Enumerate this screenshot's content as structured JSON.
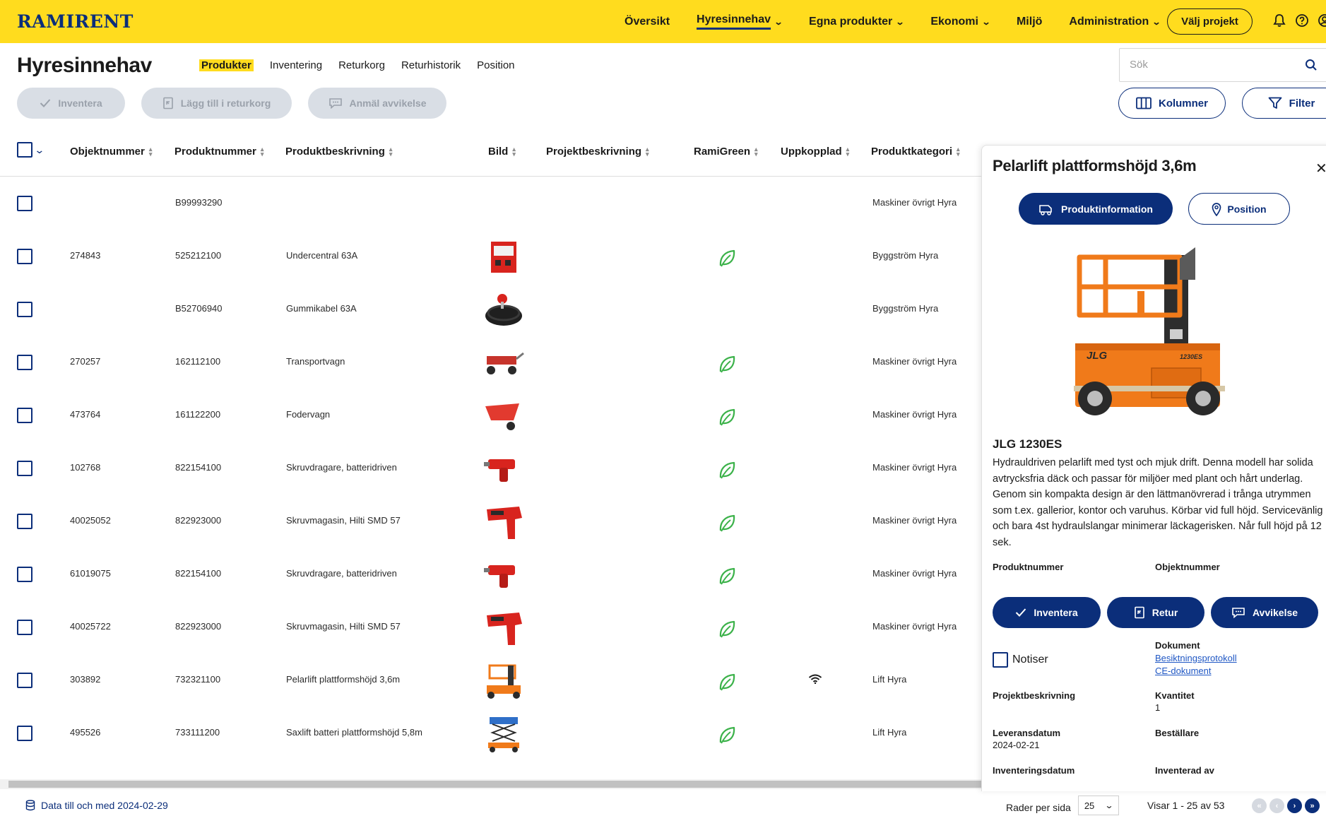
{
  "brand": {
    "logo_text": "RAMIRENT",
    "accent": "#ffdc1e",
    "primary": "#0b2e7a"
  },
  "topnav": {
    "items": [
      {
        "label": "Översikt"
      },
      {
        "label": "Hyresinnehav"
      },
      {
        "label": "Egna produkter"
      },
      {
        "label": "Ekonomi"
      },
      {
        "label": "Miljö"
      },
      {
        "label": "Administration"
      }
    ],
    "project_button": "Välj projekt",
    "icons": [
      "bell-icon",
      "help-icon",
      "user-icon"
    ]
  },
  "page": {
    "title": "Hyresinnehav",
    "subtabs": [
      "Produkter",
      "Inventering",
      "Returkorg",
      "Returhistorik",
      "Position"
    ],
    "active_subtab": "Produkter"
  },
  "search": {
    "placeholder": "Sök",
    "value": ""
  },
  "actions": {
    "inventera": "Inventera",
    "returkorg": "Lägg till i returkorg",
    "avvikelse": "Anmäl avvikelse",
    "kolumner": "Kolumner",
    "filter": "Filter"
  },
  "table": {
    "columns": [
      "Objektnummer",
      "Produktnummer",
      "Produktbeskrivning",
      "Bild",
      "Projektbeskrivning",
      "RamiGreen",
      "Uppkopplad",
      "Produktkategori"
    ],
    "rows": [
      {
        "obj": "",
        "prod": "B99993290",
        "desc": "",
        "image": "",
        "green": false,
        "wifi": false,
        "cat": "Maskiner övrigt Hyra"
      },
      {
        "obj": "274843",
        "prod": "525212100",
        "desc": "Undercentral 63A",
        "image": "distribution-box",
        "green": true,
        "wifi": false,
        "cat": "Byggström Hyra"
      },
      {
        "obj": "",
        "prod": "B52706940",
        "desc": "Gummikabel 63A",
        "image": "cable-reel",
        "green": false,
        "wifi": false,
        "cat": "Byggström Hyra"
      },
      {
        "obj": "270257",
        "prod": "162112100",
        "desc": "Transportvagn",
        "image": "cart",
        "green": true,
        "wifi": false,
        "cat": "Maskiner övrigt Hyra"
      },
      {
        "obj": "473764",
        "prod": "161122200",
        "desc": "Fodervagn",
        "image": "wheelbarrow",
        "green": true,
        "wifi": false,
        "cat": "Maskiner övrigt Hyra"
      },
      {
        "obj": "102768",
        "prod": "822154100",
        "desc": "Skruvdragare, batteridriven",
        "image": "screwdriver",
        "green": true,
        "wifi": false,
        "cat": "Maskiner övrigt Hyra"
      },
      {
        "obj": "40025052",
        "prod": "822923000",
        "desc": "Skruvmagasin, Hilti SMD 57",
        "image": "magazine",
        "green": true,
        "wifi": false,
        "cat": "Maskiner övrigt Hyra"
      },
      {
        "obj": "61019075",
        "prod": "822154100",
        "desc": "Skruvdragare, batteridriven",
        "image": "screwdriver",
        "green": true,
        "wifi": false,
        "cat": "Maskiner övrigt Hyra"
      },
      {
        "obj": "40025722",
        "prod": "822923000",
        "desc": "Skruvmagasin, Hilti SMD 57",
        "image": "magazine",
        "green": true,
        "wifi": false,
        "cat": "Maskiner övrigt Hyra"
      },
      {
        "obj": "303892",
        "prod": "732321100",
        "desc": "Pelarlift plattformshöjd 3,6m",
        "image": "vertical-lift",
        "green": true,
        "wifi": true,
        "cat": "Lift Hyra"
      },
      {
        "obj": "495526",
        "prod": "733111200",
        "desc": "Saxlift batteri plattformshöjd 5,8m",
        "image": "scissor-lift",
        "green": true,
        "wifi": false,
        "cat": "Lift Hyra"
      }
    ]
  },
  "footer": {
    "data_info": "Data till och med 2024-02-29",
    "rows_per_page_label": "Rader per sida",
    "rows_per_page": "25",
    "showing": "Visar 1 - 25 av 53"
  },
  "panel": {
    "title": "Pelarlift plattformshöjd 3,6m",
    "tab_info": "Produktinformation",
    "tab_position": "Position",
    "model": "JLG 1230ES",
    "model_plate": "1230ES",
    "brand_plate": "JLG",
    "description": "Hydrauldriven pelarlift med tyst och mjuk drift. Denna modell har solida avtrycksfria däck och passar för miljöer med plant och hårt underlag. Genom sin kompakta design är den lättmanövrerad i trånga utrymmen som t.ex. gallerior, kontor och varuhus. Körbar vid full höjd. Servicevänlig och bara 4st hydraulslangar minimerar läckagerisken. Når full höjd på 12 sek.",
    "labels": {
      "produktnummer": "Produktnummer",
      "objektnummer": "Objektnummer",
      "dokument": "Dokument",
      "projektbeskrivning": "Projektbeskrivning",
      "kvantitet": "Kvantitet",
      "leveransdatum": "Leveransdatum",
      "bestallare": "Beställare",
      "inventeringsdatum": "Inventeringsdatum",
      "inventerad_av": "Inventerad av"
    },
    "values": {
      "kvantitet": "1",
      "leveransdatum": "2024-02-21"
    },
    "buttons": {
      "inventera": "Inventera",
      "retur": "Retur",
      "avvikelse": "Avvikelse"
    },
    "notiser": "Notiser",
    "documents": [
      "Besiktningsprotokoll",
      "CE-dokument"
    ]
  }
}
